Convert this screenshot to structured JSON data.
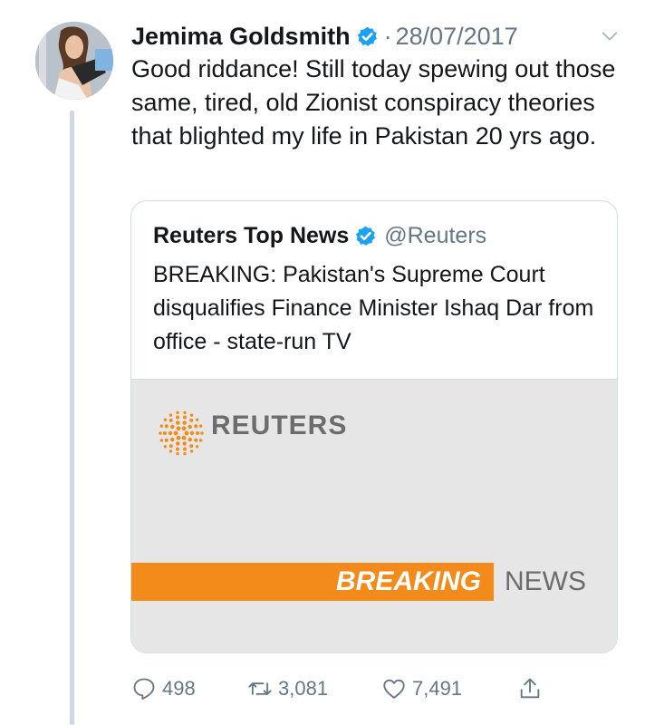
{
  "tweet": {
    "author_name": "Jemima Goldsmith",
    "separator": "·",
    "date": "28/07/2017",
    "text": "Good riddance! Still today spewing out those same, tired, old Zionist conspiracy theories that blighted my life in Pakistan 20 yrs ago.",
    "avatar": "profile-photo"
  },
  "quoted_tweet": {
    "author_name": "Reuters Top News",
    "handle": "@Reuters",
    "text": "BREAKING: Pakistan's Supreme Court disqualifies Finance Minister Ishaq Dar from office - state-run TV",
    "media": {
      "logo_text": "REUTERS",
      "breaking_label": "BREAKING",
      "news_label": "NEWS"
    }
  },
  "actions": {
    "replies": "498",
    "retweets": "3,081",
    "likes": "7,491"
  },
  "colors": {
    "verified": "#1da1f2",
    "muted_text": "#657786",
    "breaking_orange": "#f38b1a",
    "reuters_gray": "#6c6c6c"
  },
  "icons": [
    "verified-badge-icon",
    "chevron-down-icon",
    "reply-icon",
    "retweet-icon",
    "like-icon",
    "share-icon",
    "reuters-logo-icon"
  ]
}
